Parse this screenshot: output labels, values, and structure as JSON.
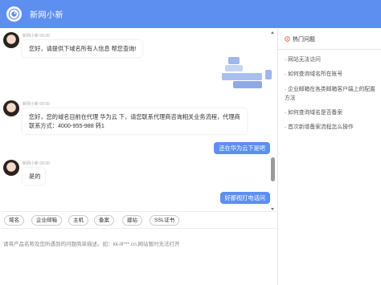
{
  "app": {
    "title": "新网小新"
  },
  "colors": {
    "header": "#5d8ff0",
    "bubble_right": "#5d8ff0",
    "faq_icon": "#e05b50"
  },
  "messages": [
    {
      "side": "left",
      "meta": "新网小新 00:00",
      "text": "您好，请提供下域名所有人信息 帮您查询!"
    },
    {
      "side": "right",
      "text": "",
      "redacted": true
    },
    {
      "side": "left",
      "meta": "新网小新 00:00",
      "lines": [
        "您好，您的域名目前在代理 华为云 下，请您联系代理商咨询相关业务流程，代理商",
        "联系方式：4000-955-988 转1"
      ]
    },
    {
      "side": "right",
      "text": "还在华为云下是吧"
    },
    {
      "side": "left",
      "meta": "新网小新 00:00",
      "text": "是的"
    },
    {
      "side": "right",
      "text": "好鄙视打电话问"
    }
  ],
  "quick_tags": [
    "域名",
    "企业邮箱",
    "主机",
    "备案",
    "建站",
    "SSL证书"
  ],
  "input": {
    "placeholder": "请将产品名称及您所遇到的问题简单描述。如：kk-lll***.cn,网站暂时无法打开"
  },
  "faq": {
    "title": "热门问题",
    "icon": "fire-icon",
    "items": [
      "网站无法访问",
      "如何查询域名所在账号",
      "企业邮箱在各类邮箱客户端上的配置方法",
      "如何查询域名是否备案",
      "首次新增备案流程怎么操作"
    ]
  }
}
